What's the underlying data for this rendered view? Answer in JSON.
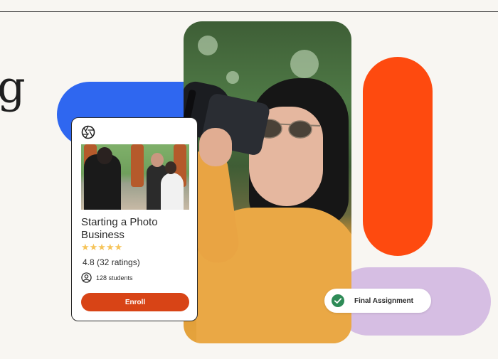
{
  "hero": {
    "partial_heading_text": "g"
  },
  "course_card": {
    "title": "Starting a Photo Business",
    "stars": "★★★★★",
    "rating_text": "4.8 (32 ratings)",
    "students_text": "128 students",
    "enroll_label": "Enroll",
    "icon": "aperture-icon"
  },
  "badge": {
    "label": "Final Assignment",
    "icon": "check-circle-icon"
  },
  "colors": {
    "background": "#f8f6f2",
    "blue_shape": "#2f67f0",
    "orange_shape": "#fe4a0f",
    "lilac_shape": "#d6bee3",
    "enroll_button": "#d84416",
    "check_green": "#2e8b57",
    "star": "#f6c45a"
  }
}
